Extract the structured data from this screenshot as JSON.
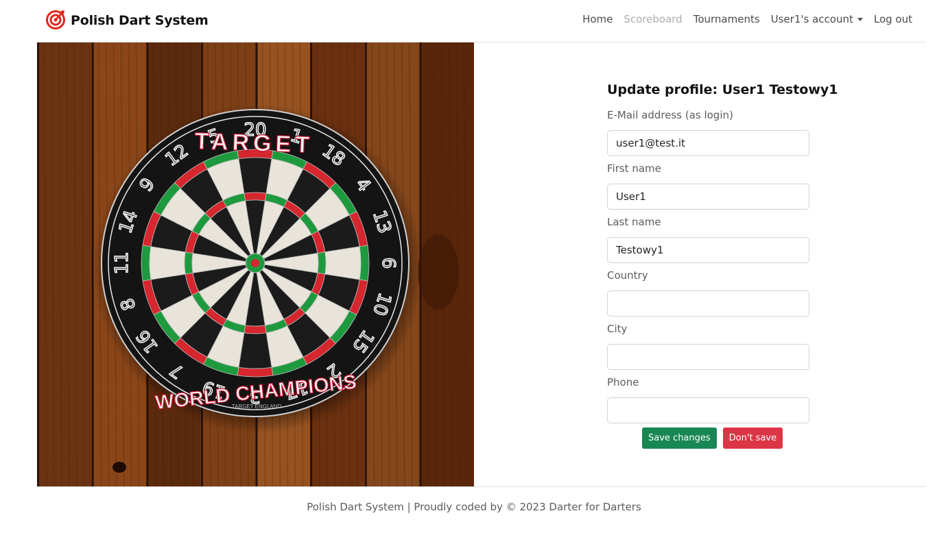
{
  "brand": {
    "name": "Polish Dart System",
    "icon": "dart-target-icon",
    "color": "#e0261b"
  },
  "nav": {
    "items": [
      {
        "label": "Home"
      },
      {
        "label": "Scoreboard",
        "disabled": true
      },
      {
        "label": "Tournaments"
      },
      {
        "label": "User1's account",
        "dropdown": true
      },
      {
        "label": "Log out"
      }
    ]
  },
  "hero": {
    "image": "dartboard-on-wooden-wall",
    "board_text": {
      "top": "TARGET",
      "bottom": "WORLD CHAMPIONS",
      "maker": "TARGET ENGLAND"
    },
    "numbers": [
      "20",
      "1",
      "18",
      "4",
      "13",
      "6",
      "10",
      "15",
      "2",
      "17",
      "3",
      "19",
      "7",
      "16",
      "8",
      "11",
      "14",
      "9",
      "12",
      "5"
    ]
  },
  "form": {
    "title": "Update profile: User1 Testowy1",
    "fields": [
      {
        "label": "E-Mail address (as login)",
        "value": "user1@test.it"
      },
      {
        "label": "First name",
        "value": "User1"
      },
      {
        "label": "Last name",
        "value": "Testowy1"
      },
      {
        "label": "Country",
        "value": ""
      },
      {
        "label": "City",
        "value": ""
      },
      {
        "label": "Phone",
        "value": ""
      }
    ],
    "save_label": "Save changes",
    "cancel_label": "Don't save"
  },
  "colors": {
    "success": "#198754",
    "danger": "#dc3545",
    "border": "#ced4da"
  },
  "footer": {
    "text": "Polish Dart System | Proudly coded by © 2023 Darter for Darters"
  }
}
